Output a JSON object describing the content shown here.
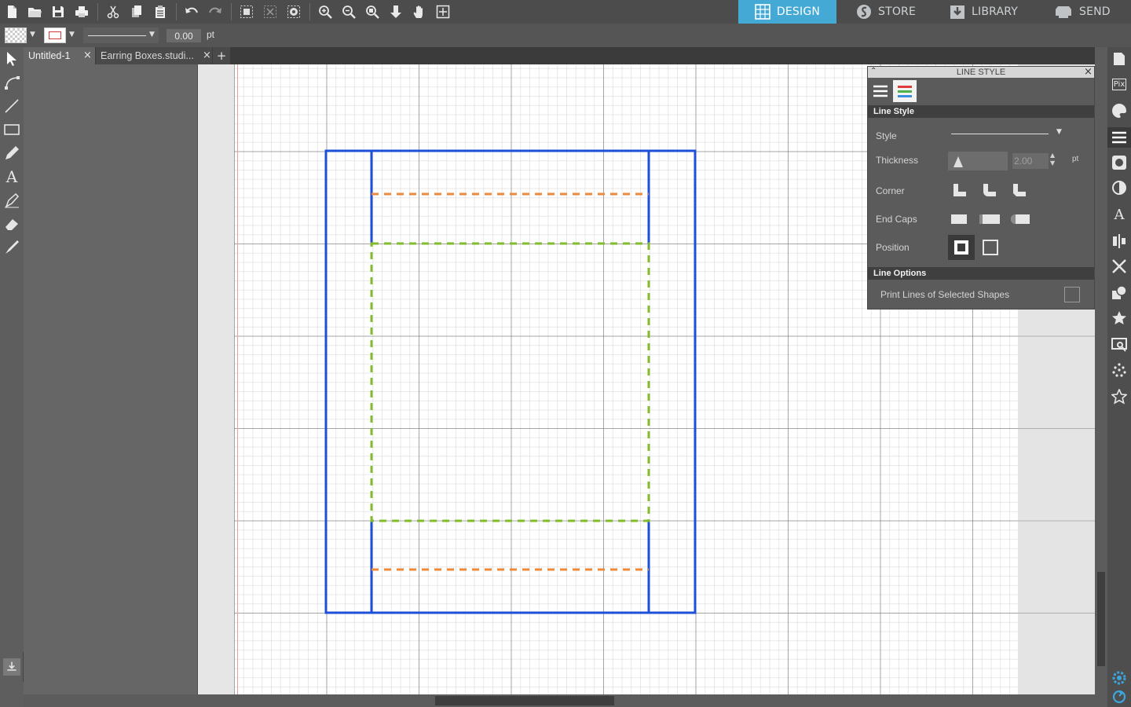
{
  "toolbar": {
    "icons": [
      "new-file",
      "open-folder",
      "save",
      "print",
      "cut",
      "copy",
      "paste",
      "undo",
      "redo",
      "group",
      "ungroup",
      "trace",
      "zoom-in",
      "zoom-out",
      "zoom-fit",
      "pan-down",
      "hand",
      "zoom-box"
    ]
  },
  "nav": {
    "tabs": [
      {
        "label": "DESIGN",
        "active": true
      },
      {
        "label": "STORE",
        "active": false
      },
      {
        "label": "LIBRARY",
        "active": false
      },
      {
        "label": "SEND",
        "active": false
      }
    ],
    "active_color": "#45a9d6"
  },
  "options": {
    "stroke_width_value": "0.00",
    "stroke_unit": "pt"
  },
  "doc_tabs": [
    {
      "label": "Untitled-1",
      "active": true
    },
    {
      "label": "Earring Boxes.studi...",
      "active": false
    }
  ],
  "add_tab": "+",
  "close_glyph": "×",
  "line_style_panel": {
    "title": "LINE STYLE",
    "section_line_style": "Line Style",
    "style_label": "Style",
    "thickness_label": "Thickness",
    "thickness_value": "2.00",
    "thickness_unit": "pt",
    "corner_label": "Corner",
    "end_caps_label": "End Caps",
    "position_label": "Position",
    "section_line_options": "Line Options",
    "print_lines_label": "Print Lines of Selected Shapes"
  },
  "colors": {
    "cut_line": "#1d4fd9",
    "orange_dash": "#ec8a3c",
    "green_dash": "#82bc2a"
  }
}
